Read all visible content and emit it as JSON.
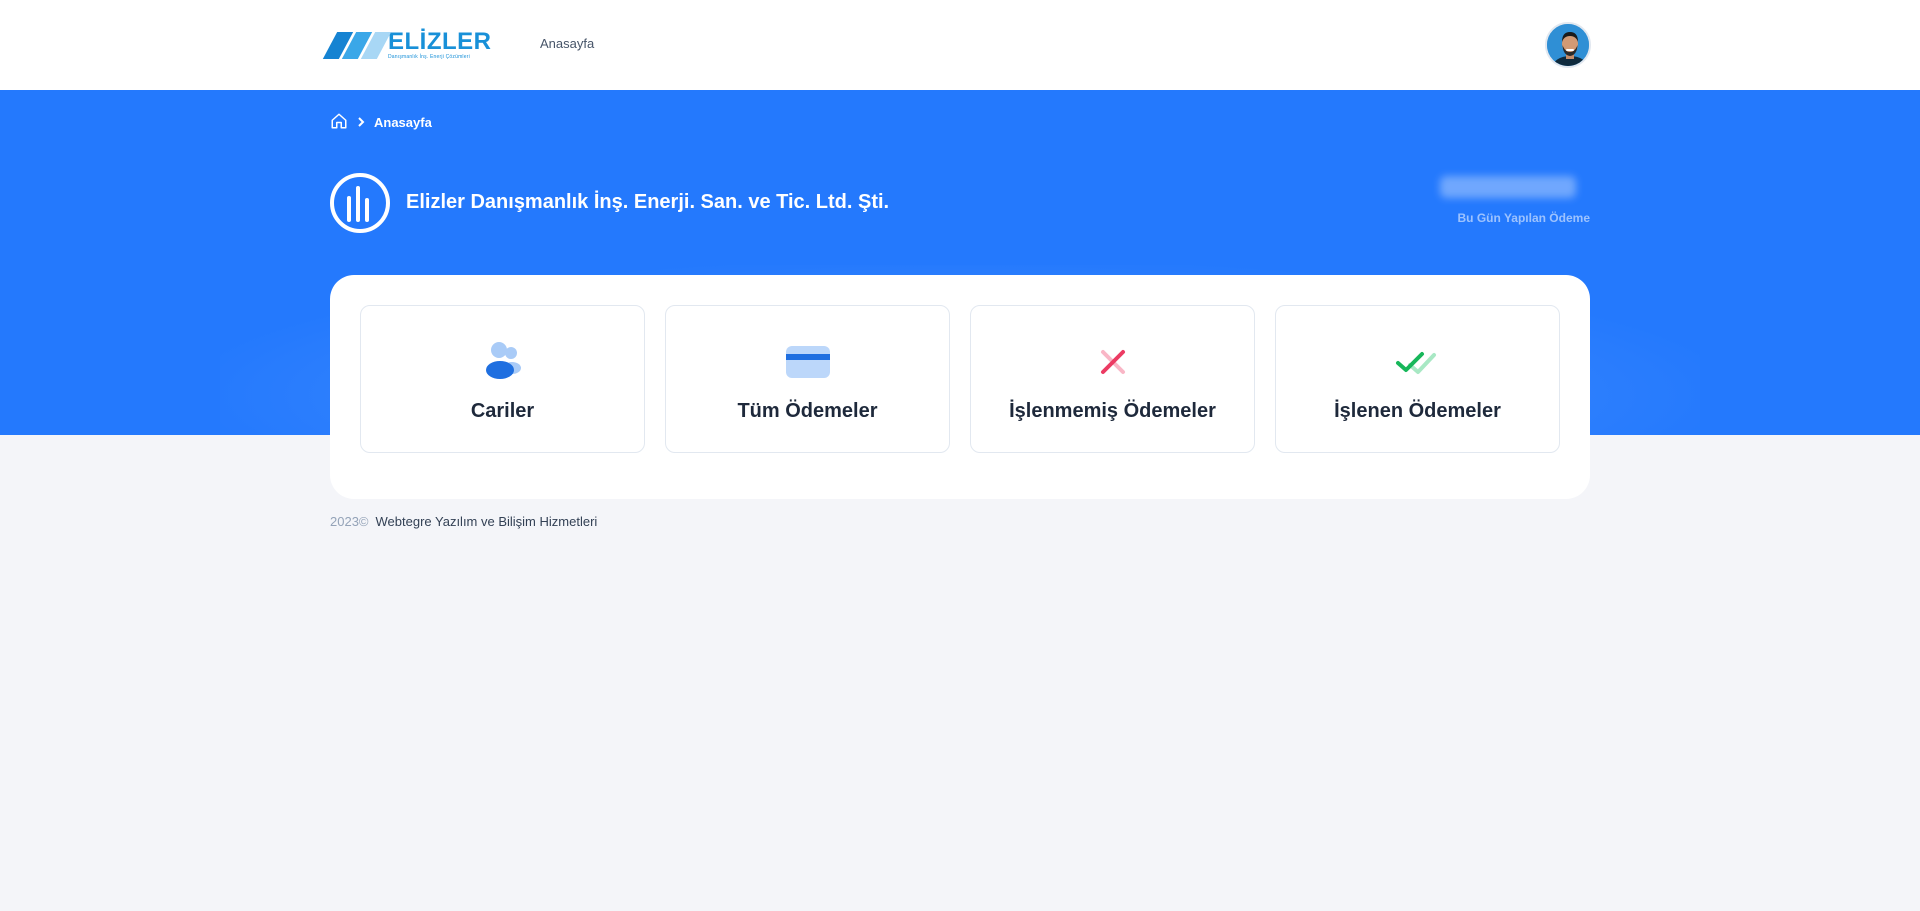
{
  "header": {
    "logo": {
      "name": "ELİZLER",
      "subtitle": "Danışmanlık İnş. Enerji Çözümleri",
      "stripe_colors": [
        "#1583d2",
        "#3aa7e8",
        "#a8d7f5"
      ]
    },
    "nav": [
      {
        "label": "Anasayfa"
      }
    ],
    "avatar_icon": "user-avatar"
  },
  "hero": {
    "breadcrumb": {
      "home_icon": "home-icon",
      "separator_icon": "chevron-right-icon",
      "current": "Anasayfa"
    },
    "company_name": "Elizler Danışmanlık İnş. Enerji. San. ve Tic. Ltd. Şti.",
    "today_payment_label": "Bu Gün Yapılan Ödeme",
    "colors": {
      "hero_bg": "#2479fd",
      "page_bg": "#f4f5f9"
    }
  },
  "tiles": [
    {
      "label": "Cariler",
      "icon": "users-icon"
    },
    {
      "label": "Tüm Ödemeler",
      "icon": "credit-card-icon"
    },
    {
      "label": "İşlenmemiş Ödemeler",
      "icon": "close-icon"
    },
    {
      "label": "İşlenen Ödemeler",
      "icon": "double-check-icon"
    }
  ],
  "footer": {
    "year": "2023©",
    "company": "Webtegre Yazılım ve Bilişim Hizmetleri"
  }
}
